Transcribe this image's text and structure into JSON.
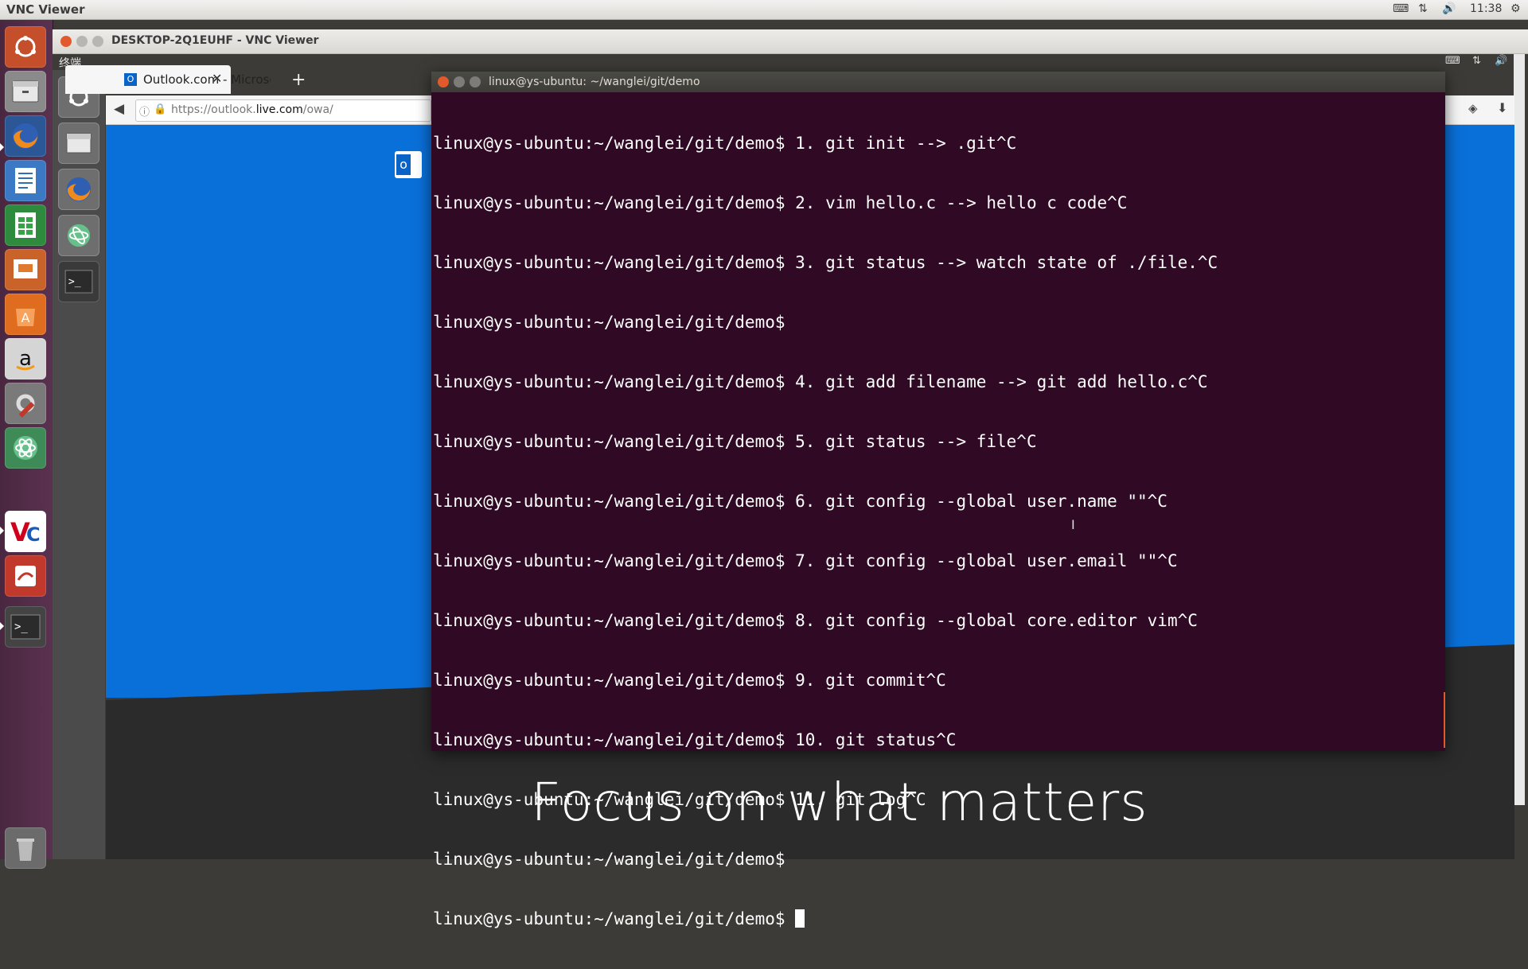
{
  "top_panel": {
    "title": "VNC Viewer",
    "time": "11:38",
    "tray_icons": [
      "keyboard-icon",
      "network-icon",
      "volume-icon",
      "gear-icon"
    ]
  },
  "launcher": {
    "items": [
      "ubuntu-dash-icon",
      "files-icon",
      "firefox-icon",
      "writer-icon",
      "calc-icon",
      "impress-icon",
      "software-center-icon",
      "amazon-icon",
      "settings-icon",
      "atom-icon",
      "vnc-icon",
      "draw-icon",
      "terminal-icon",
      "trash-icon"
    ]
  },
  "vnc_window": {
    "title": "DESKTOP-2Q1EUHF - VNC Viewer"
  },
  "remote": {
    "panel_title": "终端",
    "firefox": {
      "tab_label": "Outlook.com - Microsc",
      "url_prefix": "https://outlook.",
      "url_host": "live.com",
      "url_suffix": "/owa/",
      "hero_text": "Focus on what matters"
    },
    "terminal": {
      "title": "linux@ys-ubuntu: ~/wanglei/git/demo",
      "prompt": "linux@ys-ubuntu:~/wanglei/git/demo$",
      "lines": [
        "linux@ys-ubuntu:~/wanglei/git/demo$ 1. git init --> .git^C",
        "linux@ys-ubuntu:~/wanglei/git/demo$ 2. vim hello.c --> hello c code^C",
        "linux@ys-ubuntu:~/wanglei/git/demo$ 3. git status --> watch state of ./file.^C",
        "linux@ys-ubuntu:~/wanglei/git/demo$",
        "linux@ys-ubuntu:~/wanglei/git/demo$ 4. git add filename --> git add hello.c^C",
        "linux@ys-ubuntu:~/wanglei/git/demo$ 5. git status --> file^C",
        "linux@ys-ubuntu:~/wanglei/git/demo$ 6. git config --global user.name \"\"^C",
        "linux@ys-ubuntu:~/wanglei/git/demo$ 7. git config --global user.email \"\"^C",
        "linux@ys-ubuntu:~/wanglei/git/demo$ 8. git config --global core.editor vim^C",
        "linux@ys-ubuntu:~/wanglei/git/demo$ 9. git commit^C",
        "linux@ys-ubuntu:~/wanglei/git/demo$ 10. git status^C",
        "linux@ys-ubuntu:~/wanglei/git/demo$ 11. git log^C",
        "linux@ys-ubuntu:~/wanglei/git/demo$"
      ]
    }
  },
  "colors": {
    "terminal_bg": "#300a24",
    "outlook_blue": "#0a70d9",
    "launcher": "#4a2740"
  }
}
